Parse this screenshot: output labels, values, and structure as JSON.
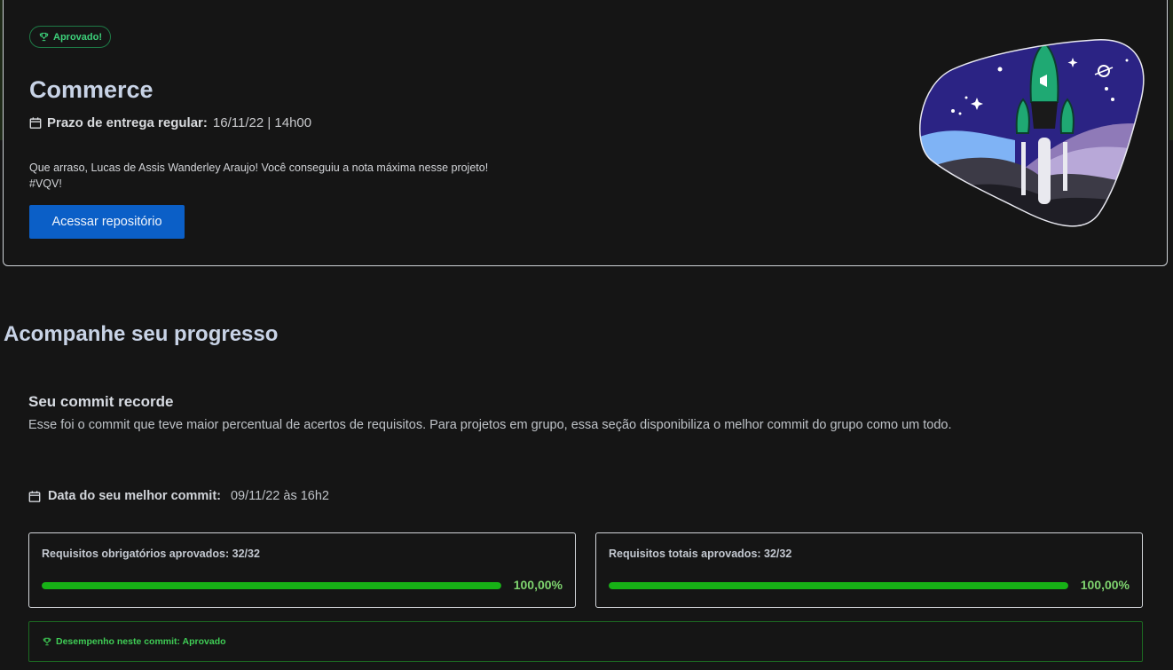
{
  "hero": {
    "badge_label": "Aprovado!",
    "title": "Commerce",
    "deadline_label": "Prazo de entrega regular:",
    "deadline_value": "16/11/22 | 14h00",
    "message_line1": "Que arraso, Lucas de Assis Wanderley Araujo! Você conseguiu a nota máxima nesse projeto!",
    "message_line2": "#VQV!",
    "repo_button": "Acessar repositório"
  },
  "progress": {
    "section_title": "Acompanhe seu progresso",
    "commit_title": "Seu commit recorde",
    "commit_desc": "Esse foi o commit que teve maior percentual de acertos de requisitos. Para projetos em grupo, essa seção disponibiliza o melhor commit do grupo como um todo.",
    "best_date_label": "Data do seu melhor commit:",
    "best_date_value": "09/11/22 às 16h2",
    "cards": [
      {
        "title": "Requisitos obrigatórios aprovados: 32/32",
        "percent_label": "100,00%",
        "fill": 1.0
      },
      {
        "title": "Requisitos totais aprovados: 32/32",
        "percent_label": "100,00%",
        "fill": 1.0
      }
    ],
    "performance_label": "Desempenho neste commit: Aprovado"
  },
  "colors": {
    "accent_blue": "#0b5fc7",
    "success_green": "#17b116",
    "badge_green": "#3dd07a"
  },
  "icons": [
    "trophy-icon",
    "calendar-icon",
    "rocket-illustration"
  ]
}
